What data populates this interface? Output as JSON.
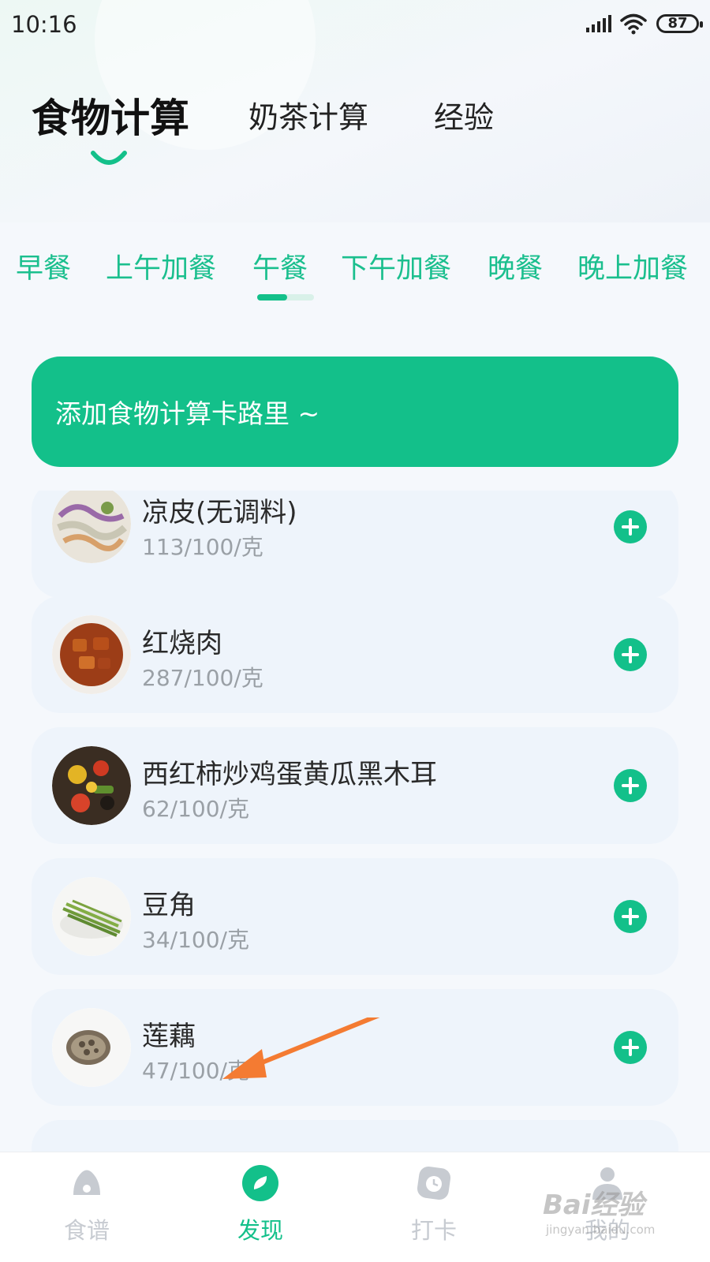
{
  "status_bar": {
    "time": "10:16",
    "battery": "87"
  },
  "top_tabs": [
    {
      "label": "食物计算",
      "active": true
    },
    {
      "label": "奶茶计算",
      "active": false
    },
    {
      "label": "经验",
      "active": false
    }
  ],
  "meal_tabs": [
    {
      "label": "早餐"
    },
    {
      "label": "上午加餐"
    },
    {
      "label": "午餐",
      "active": true
    },
    {
      "label": "下午加餐"
    },
    {
      "label": "晚餐"
    },
    {
      "label": "晚上加餐"
    }
  ],
  "add_banner": {
    "label": "添加食物计算卡路里 ~"
  },
  "foods": [
    {
      "name": "凉皮(无调料)",
      "calories": "113/100/克",
      "image": "liangpi-photo"
    },
    {
      "name": "红烧肉",
      "calories": "287/100/克",
      "image": "braised-pork-photo"
    },
    {
      "name": "西红柿炒鸡蛋黄瓜黑木耳",
      "calories": "62/100/克",
      "image": "tomato-egg-photo"
    },
    {
      "name": "豆角",
      "calories": "34/100/克",
      "image": "green-beans-photo"
    },
    {
      "name": "莲藕",
      "calories": "47/100/克",
      "image": "lotus-root-photo"
    }
  ],
  "bottom_nav": [
    {
      "label": "食谱",
      "icon": "recipe-icon"
    },
    {
      "label": "发现",
      "icon": "discover-icon",
      "active": true
    },
    {
      "label": "打卡",
      "icon": "checkin-icon"
    },
    {
      "label": "我的",
      "icon": "profile-icon"
    }
  ],
  "watermark": {
    "main": "Bai经验",
    "sub": "jingyan.baidu.com"
  },
  "colors": {
    "accent": "#13c08a",
    "tab_text": "#1bbf8e",
    "card_bg": "#eef4fb",
    "annotation_arrow": "#f47b32"
  }
}
